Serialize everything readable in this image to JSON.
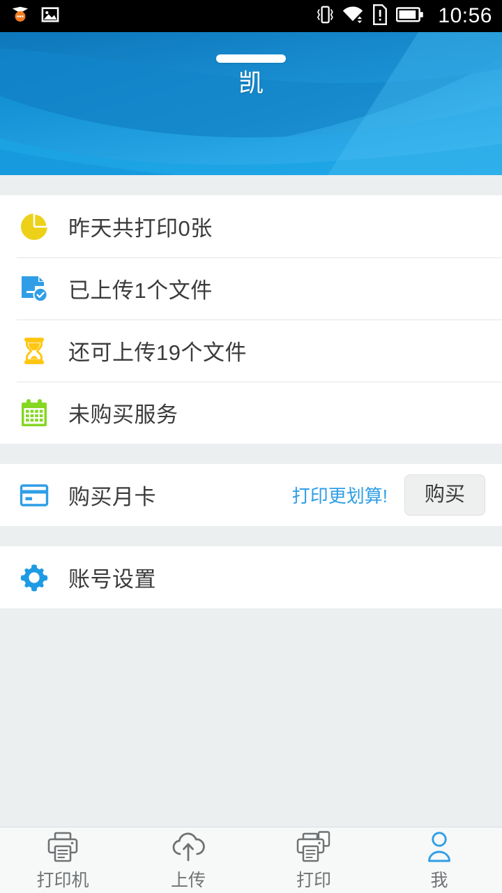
{
  "statusbar": {
    "time": "10:56",
    "icons": [
      "owl-notification-icon",
      "image-icon",
      "vibrate-icon",
      "wifi-icon",
      "sim-alert-icon",
      "battery-icon"
    ]
  },
  "header": {
    "title": "凯",
    "name_pill": "name-placeholder-bar",
    "colors": {
      "dark": "#0f7ac0",
      "mid": "#1a8fd2",
      "light": "#3cb6ef"
    }
  },
  "stats": {
    "items": [
      {
        "icon": "pie-chart-icon",
        "label": "昨天共打印0张",
        "color": "#edd119"
      },
      {
        "icon": "document-check-icon",
        "label": "已上传1个文件",
        "color": "#2f9ee6"
      },
      {
        "icon": "hourglass-icon",
        "label": "还可上传19个文件",
        "color": "#ffc713"
      },
      {
        "icon": "calendar-icon",
        "label": "未购买服务",
        "color": "#85d723"
      }
    ]
  },
  "purchase": {
    "icon": "credit-card-icon",
    "label": "购买月卡",
    "promo": "打印更划算!",
    "button": "购买",
    "accent": "#2f9ee6"
  },
  "settings": {
    "icon": "gear-icon",
    "label": "账号设置",
    "color": "#2f9ee6"
  },
  "tabbar": {
    "active_index": 3,
    "active_color": "#2f9ee6",
    "inactive_color": "#6f7273",
    "tabs": [
      {
        "icon": "printer-icon",
        "label": "打印机"
      },
      {
        "icon": "cloud-upload-icon",
        "label": "上传"
      },
      {
        "icon": "print-document-icon",
        "label": "打印"
      },
      {
        "icon": "person-icon",
        "label": "我"
      }
    ]
  }
}
